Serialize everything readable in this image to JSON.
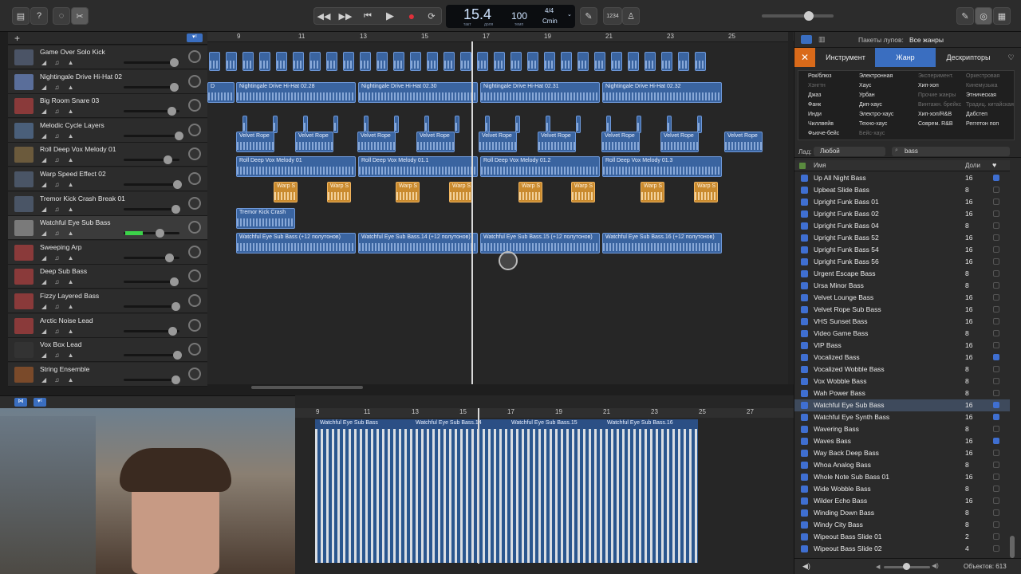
{
  "lcd": {
    "position": "15.4",
    "pos_sub1": "такт",
    "pos_sub2": "доля",
    "tempo": "100",
    "tempo_sub": "темп",
    "sig": "4/4",
    "key": "Cmin"
  },
  "toolbar": {
    "count_in": "1234"
  },
  "ruler": [
    "9",
    "11",
    "13",
    "15",
    "17",
    "19",
    "21",
    "23",
    "25"
  ],
  "tracks": [
    {
      "name": "Game Over Solo Kick"
    },
    {
      "name": "Nightingale Drive Hi-Hat 02"
    },
    {
      "name": "Big Room Snare 03"
    },
    {
      "name": "Melodic Cycle Layers"
    },
    {
      "name": "Roll Deep Vox Melody 01"
    },
    {
      "name": "Warp Speed Effect 02"
    },
    {
      "name": "Tremor Kick Crash Break 01"
    },
    {
      "name": "Watchful Eye Sub Bass"
    },
    {
      "name": "Sweeping Arp"
    },
    {
      "name": "Deep Sub Bass"
    },
    {
      "name": "Fizzy Layered Bass"
    },
    {
      "name": "Arctic Noise Lead"
    },
    {
      "name": "Vox Box Lead"
    },
    {
      "name": "String Ensemble"
    }
  ],
  "regions": {
    "hihat": [
      "D",
      "Nightingale Drive Hi-Hat 02.28",
      "Nightingale Drive Hi-Hat 02.30",
      "Nightingale Drive Hi-Hat 02.31",
      "Nightingale Drive Hi-Hat 02.32"
    ],
    "velvet": "Velvet Rope",
    "vox": [
      "Roll Deep Vox Melody 01",
      "Roll Deep Vox Melody 01.1",
      "Roll Deep Vox Melody 01.2",
      "Roll Deep Vox Melody 01.3"
    ],
    "warp": "Warp S",
    "tremor": "Tremor Kick Crash",
    "bass": [
      "Watchful Eye Sub Bass (+12 полутонов)",
      "Watchful Eye Sub Bass.14 (+12 полутонов)",
      "Watchful Eye Sub Bass.15 (+12 полутонов)",
      "Watchful Eye Sub Bass.16 (+12 полутонов)"
    ]
  },
  "editor": {
    "ruler": [
      "9",
      "11",
      "13",
      "15",
      "17",
      "19",
      "21",
      "23",
      "25",
      "27"
    ],
    "regions": [
      "Watchful Eye Sub Bass",
      "Watchful Eye Sub Bass.14",
      "Watchful Eye Sub Bass.15",
      "Watchful Eye Sub Bass.16"
    ]
  },
  "loops": {
    "packs_label": "Пакеты лупов:",
    "packs_value": "Все жанры",
    "tabs": [
      "Инструмент",
      "Жанр",
      "Дескрипторы"
    ],
    "genres": [
      [
        "Рок/блюз",
        "Электронная",
        "Эксперимент.",
        "Оркестровая"
      ],
      [
        "Хэнгтн",
        "Хаус",
        "Хип-хоп",
        "Кинемузыка"
      ],
      [
        "Джаз",
        "Урбан",
        "Прочие жанры",
        "Этническая"
      ],
      [
        "Фанк",
        "Дип-хаус",
        "Винтажн. брейкс",
        "Традиц. китайская"
      ],
      [
        "Инди",
        "Электро-хаус",
        "Хип-хоп/R&B",
        "Дабстеп"
      ],
      [
        "Чиллвейв",
        "Техно-хаус",
        "Соврем. R&B",
        "Реггетон поп"
      ],
      [
        "Фьюче-бейс",
        "Бейс-хаус",
        "",
        ""
      ]
    ],
    "scale_label": "Лад:",
    "scale_value": "Любой",
    "search_value": "bass",
    "col_name": "Имя",
    "col_beats": "Доли",
    "items": [
      {
        "name": "Up All Night Bass",
        "beats": "16",
        "fav": true
      },
      {
        "name": "Upbeat Slide Bass",
        "beats": "8",
        "fav": false
      },
      {
        "name": "Upright Funk Bass 01",
        "beats": "16",
        "fav": false
      },
      {
        "name": "Upright Funk Bass 02",
        "beats": "16",
        "fav": false
      },
      {
        "name": "Upright Funk Bass 04",
        "beats": "8",
        "fav": false
      },
      {
        "name": "Upright Funk Bass 52",
        "beats": "16",
        "fav": false
      },
      {
        "name": "Upright Funk Bass 54",
        "beats": "16",
        "fav": false
      },
      {
        "name": "Upright Funk Bass 56",
        "beats": "16",
        "fav": false
      },
      {
        "name": "Urgent Escape Bass",
        "beats": "8",
        "fav": false
      },
      {
        "name": "Ursa Minor Bass",
        "beats": "8",
        "fav": false
      },
      {
        "name": "Velvet Lounge Bass",
        "beats": "16",
        "fav": false
      },
      {
        "name": "Velvet Rope Sub Bass",
        "beats": "16",
        "fav": false
      },
      {
        "name": "VHS Sunset Bass",
        "beats": "16",
        "fav": false
      },
      {
        "name": "Video Game Bass",
        "beats": "8",
        "fav": false
      },
      {
        "name": "VIP Bass",
        "beats": "16",
        "fav": false
      },
      {
        "name": "Vocalized Bass",
        "beats": "16",
        "fav": true
      },
      {
        "name": "Vocalized Wobble Bass",
        "beats": "8",
        "fav": false
      },
      {
        "name": "Vox Wobble Bass",
        "beats": "8",
        "fav": false
      },
      {
        "name": "Wah Power Bass",
        "beats": "8",
        "fav": false
      },
      {
        "name": "Watchful Eye Sub Bass",
        "beats": "16",
        "fav": true
      },
      {
        "name": "Watchful Eye Synth Bass",
        "beats": "16",
        "fav": true
      },
      {
        "name": "Wavering Bass",
        "beats": "8",
        "fav": false
      },
      {
        "name": "Waves Bass",
        "beats": "16",
        "fav": true
      },
      {
        "name": "Way Back Deep Bass",
        "beats": "16",
        "fav": false
      },
      {
        "name": "Whoa Analog Bass",
        "beats": "8",
        "fav": false
      },
      {
        "name": "Whole Note Sub Bass 01",
        "beats": "16",
        "fav": false
      },
      {
        "name": "Wide Wobble Bass",
        "beats": "8",
        "fav": false
      },
      {
        "name": "Wilder Echo Bass",
        "beats": "16",
        "fav": false
      },
      {
        "name": "Winding Down Bass",
        "beats": "8",
        "fav": false
      },
      {
        "name": "Windy City Bass",
        "beats": "8",
        "fav": false
      },
      {
        "name": "Wipeout Bass Slide 01",
        "beats": "2",
        "fav": false
      },
      {
        "name": "Wipeout Bass Slide 02",
        "beats": "4",
        "fav": false
      }
    ],
    "selected_index": 19,
    "count": "Объектов: 613"
  }
}
